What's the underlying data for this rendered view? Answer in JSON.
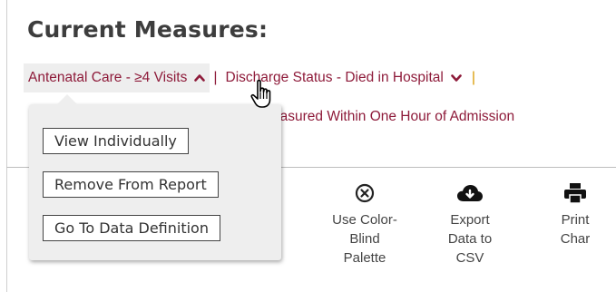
{
  "section": {
    "title": "Current Measures:"
  },
  "measures": [
    {
      "label": "Antenatal Care - ≥4 Visits",
      "chevron_icon": "chevron-up-icon"
    },
    {
      "label": "Discharge Status - Died in Hospital",
      "chevron_icon": "chevron-down-icon"
    },
    {
      "label": "easured Within One Hour of Admission"
    }
  ],
  "popup": {
    "buttons": [
      "View Individually",
      "Remove From Report",
      "Go To Data Definition"
    ]
  },
  "tools": [
    {
      "icon": "circle-x-icon",
      "lines": [
        "Use Color-",
        "Blind",
        "Palette"
      ]
    },
    {
      "icon": "cloud-download-icon",
      "lines": [
        "Export",
        "Data to",
        "CSV"
      ]
    },
    {
      "icon": "printer-icon",
      "lines": [
        "Print",
        "Char"
      ]
    }
  ],
  "colors": {
    "measure_text": "#8e1b3a",
    "separator_accent": "#d89a00",
    "title": "#3d3d3d"
  }
}
